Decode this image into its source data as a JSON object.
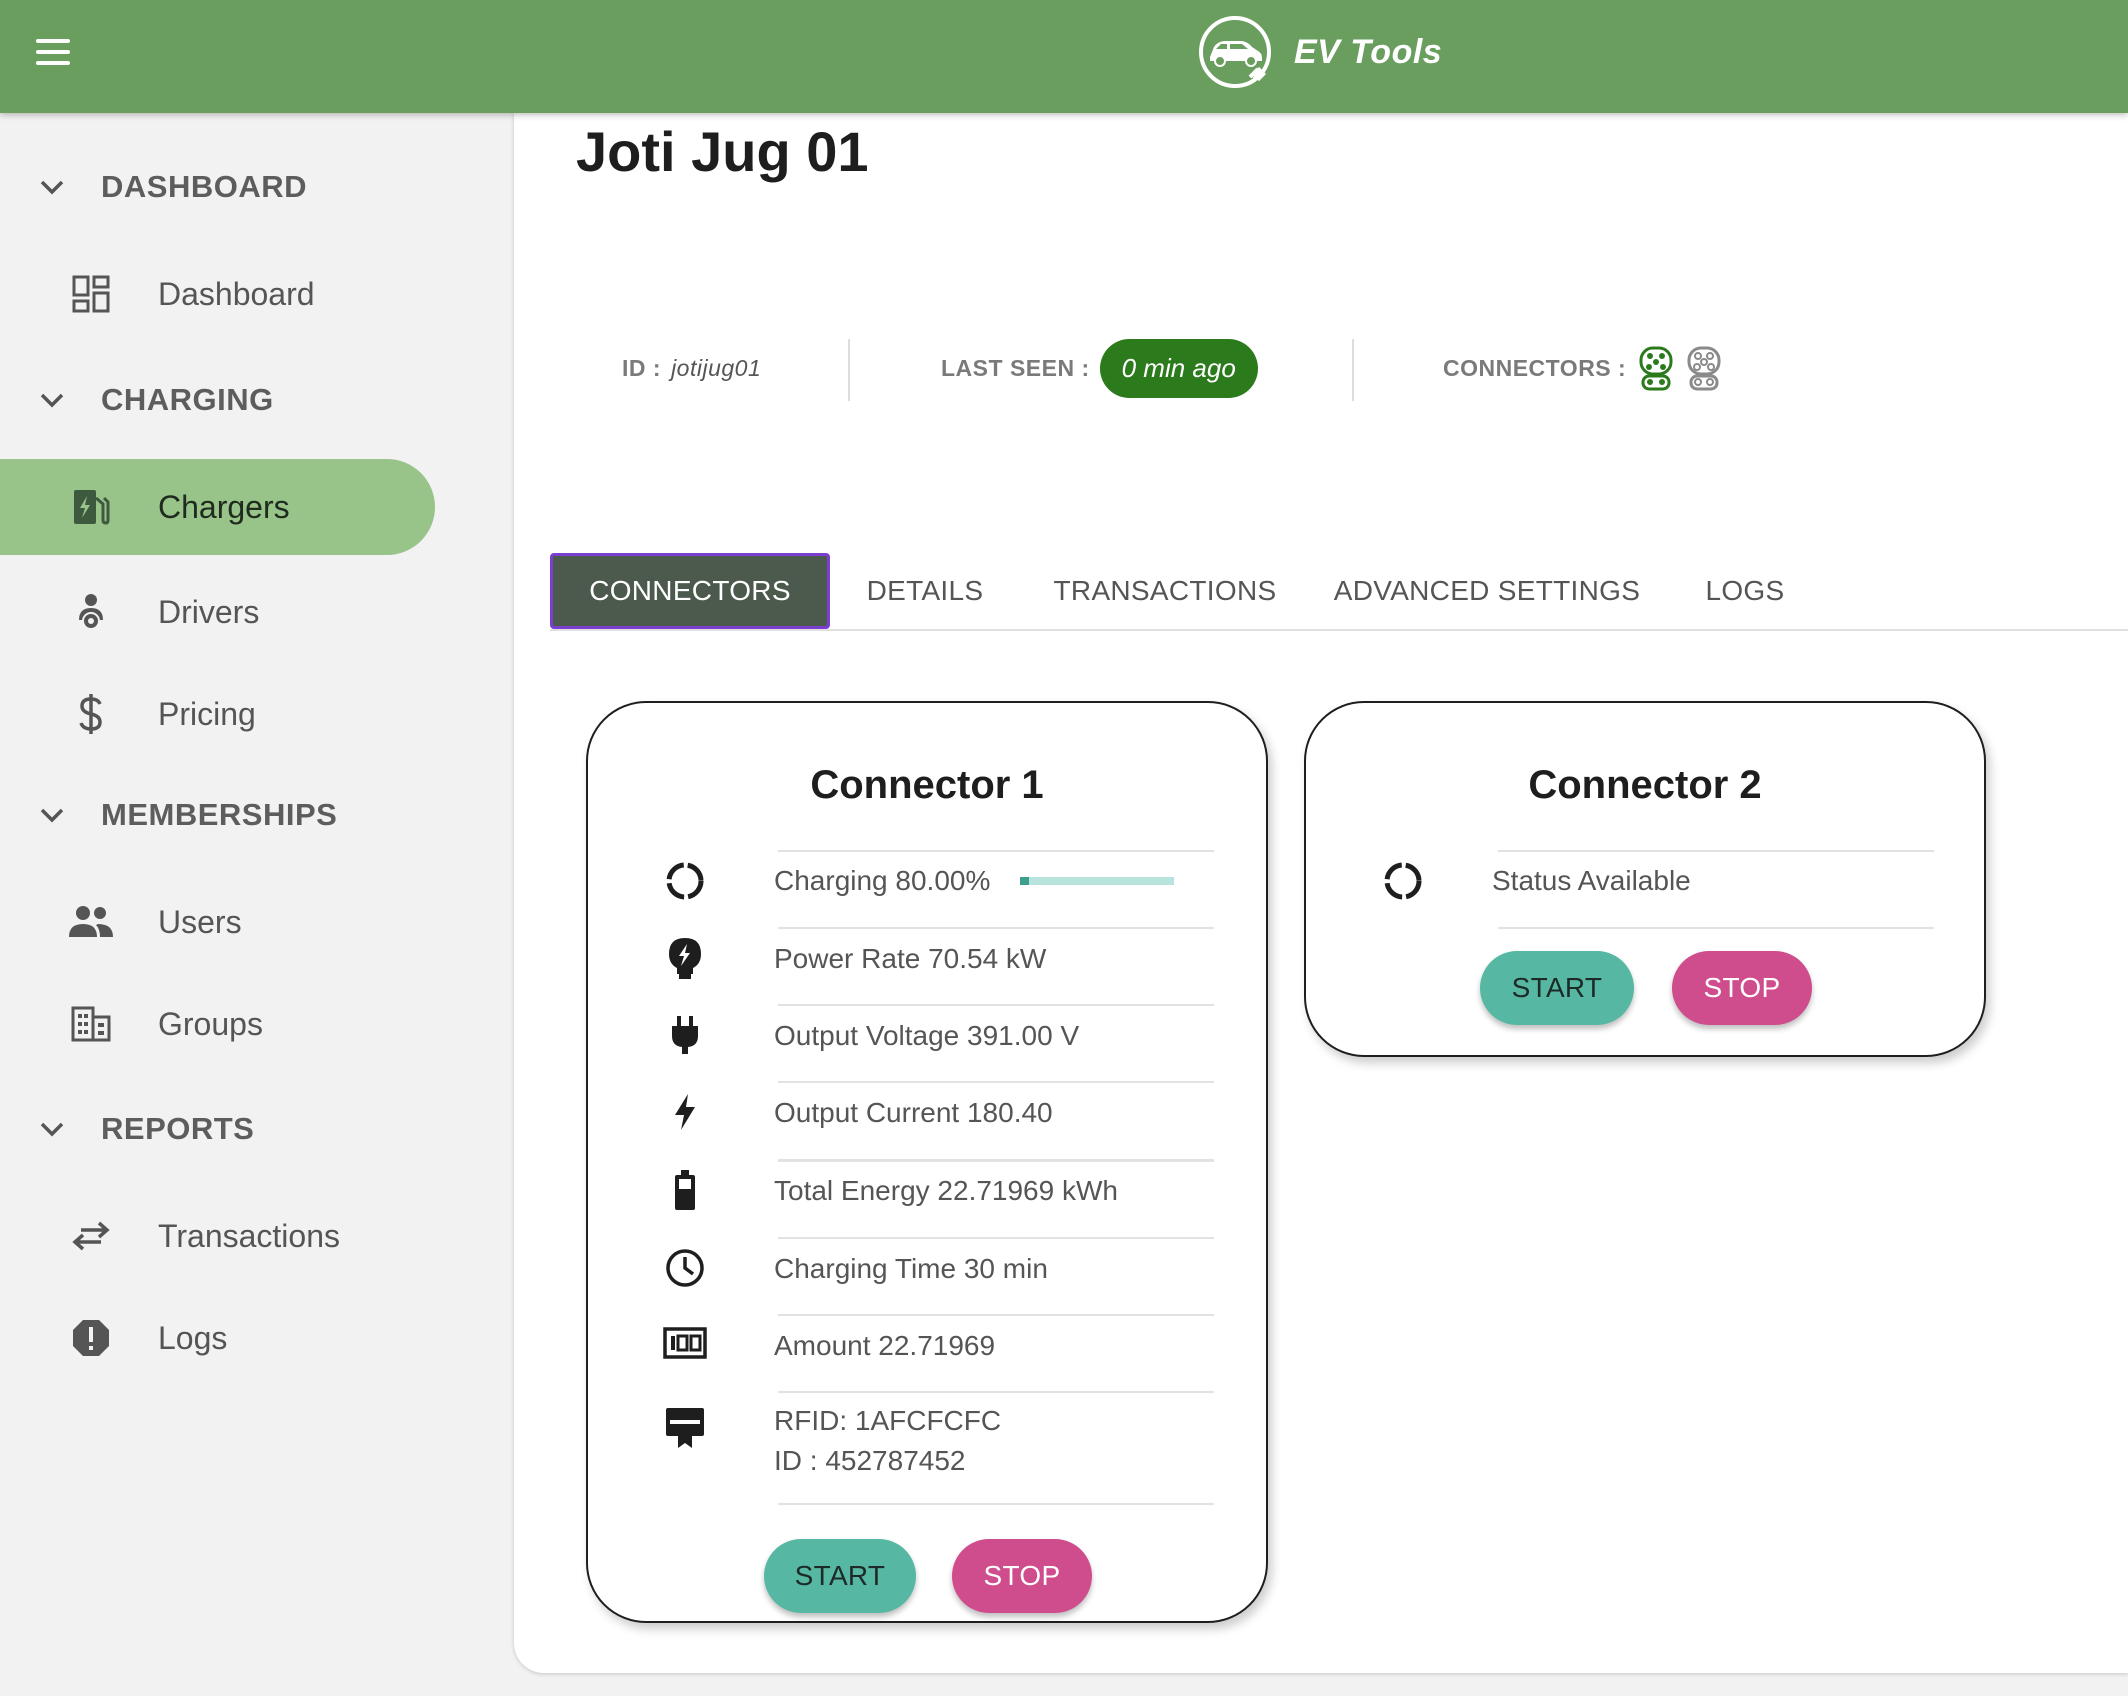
{
  "app": {
    "title": "EV Tools"
  },
  "sidebar": {
    "sections": [
      {
        "label": "DASHBOARD",
        "items": [
          {
            "label": "Dashboard",
            "icon": "dashboard-icon"
          }
        ]
      },
      {
        "label": "CHARGING",
        "items": [
          {
            "label": "Chargers",
            "icon": "ev-station-icon",
            "active": true
          },
          {
            "label": "Drivers",
            "icon": "driver-icon"
          },
          {
            "label": "Pricing",
            "icon": "dollar-icon"
          }
        ]
      },
      {
        "label": "MEMBERSHIPS",
        "items": [
          {
            "label": "Users",
            "icon": "users-icon"
          },
          {
            "label": "Groups",
            "icon": "groups-icon"
          }
        ]
      },
      {
        "label": "REPORTS",
        "items": [
          {
            "label": "Transactions",
            "icon": "swap-arrows-icon"
          },
          {
            "label": "Logs",
            "icon": "alert-octagon-icon"
          }
        ]
      }
    ]
  },
  "charger": {
    "name": "Joti Jug 01",
    "id_label": "ID :",
    "id_value": "jotijug01",
    "last_seen_label": "LAST SEEN :",
    "last_seen_value": "0 min ago",
    "connectors_label": "CONNECTORS :",
    "connector_icons": [
      {
        "icon": "connector-plug-icon",
        "color": "#2b7a1b"
      },
      {
        "icon": "connector-plug-icon",
        "color": "#8a8a8a"
      }
    ]
  },
  "tabs": [
    {
      "label": "CONNECTORS",
      "active": true
    },
    {
      "label": "DETAILS"
    },
    {
      "label": "TRANSACTIONS"
    },
    {
      "label": "ADVANCED SETTINGS"
    },
    {
      "label": "LOGS"
    }
  ],
  "connectors": [
    {
      "title": "Connector 1",
      "charging_label": "Charging 80.00%",
      "charging_progress": 0.06,
      "rows": [
        {
          "icon": "power-plug-bolt-icon",
          "text": "Power Rate 70.54 kW"
        },
        {
          "icon": "plug-icon",
          "text": "Output Voltage 391.00 V"
        },
        {
          "icon": "lightning-bolt-icon",
          "text": "Output Current 180.40"
        },
        {
          "icon": "battery-icon",
          "text": "Total Energy 22.71969 kWh"
        },
        {
          "icon": "clock-icon",
          "text": "Charging Time 30 min"
        },
        {
          "icon": "counter-100-icon",
          "text": "Amount 22.71969"
        }
      ],
      "rfid_line1": "RFID: 1AFCFCFC",
      "rfid_line2": "ID : 452787452",
      "start_label": "START",
      "stop_label": "STOP"
    },
    {
      "title": "Connector 2",
      "status_text": "Status Available",
      "start_label": "START",
      "stop_label": "STOP"
    }
  ],
  "colors": {
    "topbar": "#6a9e5f",
    "active_nav": "#98c389",
    "badge": "#2b7a1b",
    "start": "#56b7a2",
    "stop": "#cf4d8c",
    "active_tab": "#4b5a4c"
  }
}
